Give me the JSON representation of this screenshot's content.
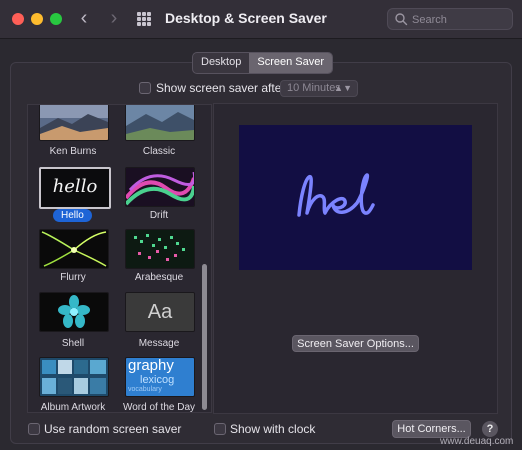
{
  "window": {
    "title": "Desktop & Screen Saver",
    "search_placeholder": "Search"
  },
  "tabs": [
    {
      "label": "Desktop",
      "active": false
    },
    {
      "label": "Screen Saver",
      "active": true
    }
  ],
  "show_after": {
    "label": "Show screen saver after",
    "checked": false,
    "value": "10 Minutes"
  },
  "savers": [
    {
      "label": "Ken Burns",
      "selected": false
    },
    {
      "label": "Classic",
      "selected": false
    },
    {
      "label": "Hello",
      "selected": true
    },
    {
      "label": "Drift",
      "selected": false
    },
    {
      "label": "Flurry",
      "selected": false
    },
    {
      "label": "Arabesque",
      "selected": false
    },
    {
      "label": "Shell",
      "selected": false
    },
    {
      "label": "Message",
      "selected": false
    },
    {
      "label": "Album Artwork",
      "selected": false
    },
    {
      "label": "Word of the Day",
      "selected": false
    }
  ],
  "tile_text": {
    "hello": "hello",
    "message": "Aa",
    "word_of_day": "graphy",
    "word_of_day_2": "lexicog",
    "word_of_day_3": "vocabulary",
    "preview": "he"
  },
  "options_button": "Screen Saver Options...",
  "random_saver": {
    "label": "Use random screen saver",
    "checked": false
  },
  "show_clock": {
    "label": "Show with clock",
    "checked": false
  },
  "hot_corners_button": "Hot Corners...",
  "help_button": "?",
  "watermark": "www.deuaq.com",
  "colors": {
    "accent": "#1e64d6",
    "preview_bg": "#120e43",
    "hello_stroke": "#7b83ff"
  }
}
